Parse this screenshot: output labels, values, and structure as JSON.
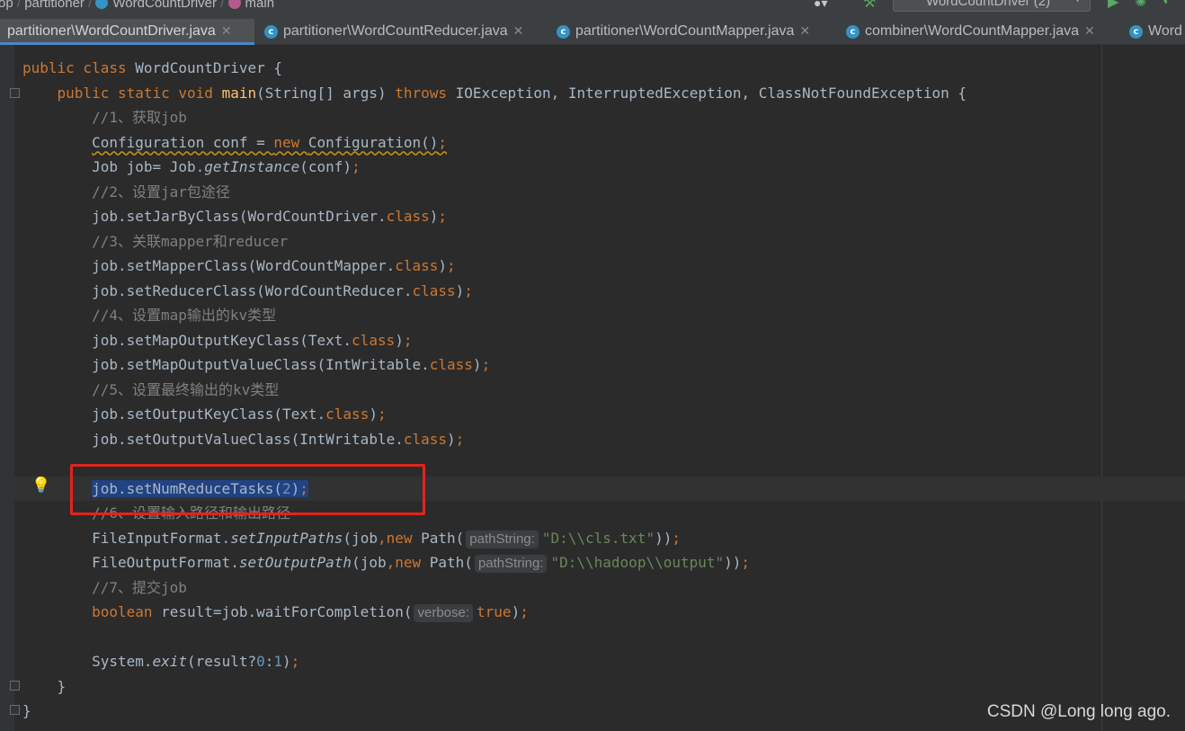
{
  "navbar": {
    "crumb_project": "op",
    "crumb_package": "partitioner",
    "crumb_class": "WordCountDriver",
    "crumb_method": "main",
    "run_config": "WordCountDriver (2)"
  },
  "tabs": [
    {
      "label": "partitioner\\WordCountDriver.java",
      "active": true
    },
    {
      "label": "partitioner\\WordCountReducer.java",
      "active": false
    },
    {
      "label": "partitioner\\WordCountMapper.java",
      "active": false
    },
    {
      "label": "combiner\\WordCountMapper.java",
      "active": false
    },
    {
      "label": "Word",
      "active": false
    }
  ],
  "code": {
    "class_name": "WordCountDriver",
    "c1": "//1、获取job",
    "c2": "//2、设置jar包途径",
    "c3": "//3、关联mapper和reducer",
    "c4": "//4、设置map输出的kv类型",
    "c5": "//5、设置最终输出的kv类型",
    "c6": "//6、设置输入路径和输出路径",
    "c7": "//7、提交job",
    "reduce_tasks": "2",
    "input_path": "\"D:\\\\cls.txt\"",
    "output_path": "\"D:\\\\hadoop\\\\output\"",
    "hint_path": "pathString:",
    "hint_verbose": "verbose:",
    "exit_expr_true": "0",
    "exit_expr_false": "1"
  },
  "watermark": "CSDN @Long long ago.",
  "colors": {
    "keyword": "#cc7832",
    "comment": "#808080",
    "method_decl": "#ffc66d",
    "string": "#6a8759",
    "number": "#6897bb",
    "highlight_box": "#e0251c"
  }
}
